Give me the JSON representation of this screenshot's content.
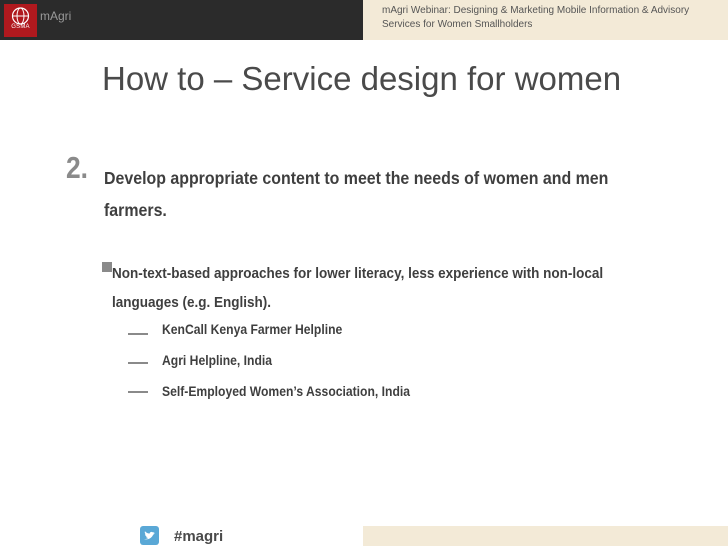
{
  "header": {
    "logo_text": "GSMA",
    "brand": "mAgri",
    "webinar_title": "mAgri Webinar: Designing & Marketing Mobile Information & Advisory Services for Women Smallholders"
  },
  "slide": {
    "title": "How to – Service design for women",
    "number": "2.",
    "point": "Develop appropriate content to meet the needs of women and men farmers.",
    "sub_point": "Non-text-based approaches for lower literacy, less experience with non-local languages (e.g. English).",
    "items": [
      "KenCall Kenya Farmer Helpline",
      "Agri Helpline, India",
      "Self-Employed Women’s Association, India"
    ]
  },
  "footer": {
    "hashtag": "#magri"
  },
  "colors": {
    "header_dark": "#2b2b2b",
    "header_beige": "#f3ead7",
    "logo_red": "#b0191e",
    "twitter_blue": "#5aa8d6"
  }
}
